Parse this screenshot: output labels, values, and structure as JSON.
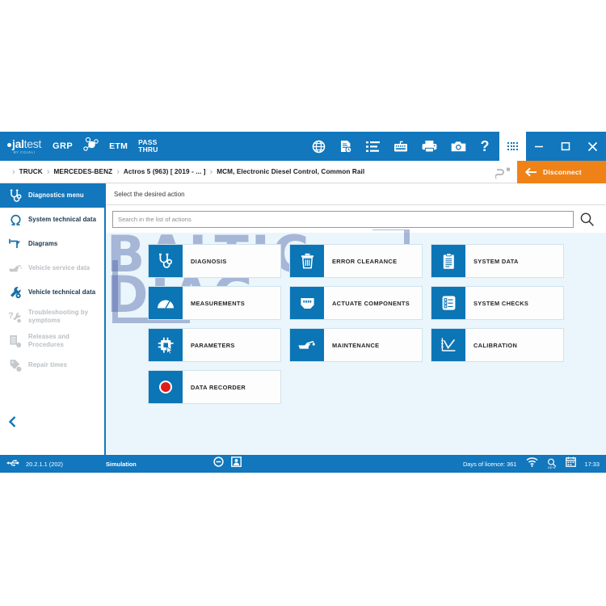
{
  "brand": {
    "logo_main": "jal",
    "logo_accent": "test",
    "logo_sub": "BY COJALI",
    "grp_label": "GRP",
    "etm_label": "ETM",
    "passthru_line1": "PASS",
    "passthru_line2": "THRU"
  },
  "colors": {
    "header_blue": "#1277bc",
    "tile_blue": "#0c75b5",
    "accent_orange": "#ef8217",
    "content_bg": "#eaf6fb",
    "watermark": "#4a5fa8",
    "record_red": "#e01b1b"
  },
  "toolbar": {
    "icons": [
      {
        "name": "globe-icon",
        "title": "Language"
      },
      {
        "name": "document-info-icon",
        "title": "Reports"
      },
      {
        "name": "list-icon",
        "title": "List"
      },
      {
        "name": "keyboard-icon",
        "title": "Keyboard"
      },
      {
        "name": "printer-icon",
        "title": "Print"
      },
      {
        "name": "camera-icon",
        "title": "Screenshot"
      },
      {
        "name": "help-icon",
        "title": "Help"
      }
    ],
    "apps_grid": "apps-grid-icon",
    "window_controls": [
      {
        "name": "minimize-button",
        "glyph": "minimize"
      },
      {
        "name": "maximize-button",
        "glyph": "maximize"
      },
      {
        "name": "close-button",
        "glyph": "close"
      }
    ]
  },
  "breadcrumb": {
    "items": [
      "TRUCK",
      "MERCEDES-BENZ",
      "Actros 5 (963) [ 2019 - ... ]",
      "MCM, Electronic Diesel Control, Common Rail"
    ],
    "separator": "›"
  },
  "disconnect": {
    "label": "Disconnect",
    "icon": "arrow-left-icon",
    "connector_icon": "connector-icon"
  },
  "sidebar": {
    "items": [
      {
        "label": "Diagnostics menu",
        "icon": "stethoscope-icon",
        "state": "active"
      },
      {
        "label": "System technical data",
        "icon": "omega-icon",
        "state": "enabled"
      },
      {
        "label": "Diagrams",
        "icon": "diagram-icon",
        "state": "enabled"
      },
      {
        "label": "Vehicle service data",
        "icon": "oil-can-icon",
        "state": "disabled"
      },
      {
        "label": "Vehicle technical data",
        "icon": "wrench-icon",
        "state": "enabled"
      },
      {
        "label": "Troubleshooting by symptoms",
        "icon": "question-wrench-icon",
        "state": "disabled"
      },
      {
        "label": "Releases and Procedures",
        "icon": "documents-icon",
        "state": "disabled"
      },
      {
        "label": "Repair times",
        "icon": "clock-tag-icon",
        "state": "disabled"
      }
    ],
    "collapse_icon": "chevron-left-icon"
  },
  "main": {
    "heading": "Select the desired action",
    "search": {
      "placeholder": "Search in the list of actions",
      "value": "",
      "icon": "search-icon"
    },
    "watermark": {
      "line1": "BALTIC",
      "line2": "DIAG"
    },
    "tiles": [
      {
        "label": "DIAGNOSIS",
        "icon": "stethoscope-icon"
      },
      {
        "label": "ERROR CLEARANCE",
        "icon": "trash-icon"
      },
      {
        "label": "SYSTEM DATA",
        "icon": "clipboard-icon"
      },
      {
        "label": "MEASUREMENTS",
        "icon": "gauge-icon"
      },
      {
        "label": "ACTUATE COMPONENTS",
        "icon": "connector-plug-icon"
      },
      {
        "label": "SYSTEM CHECKS",
        "icon": "checklist-icon"
      },
      {
        "label": "PARAMETERS",
        "icon": "chip-cursor-icon"
      },
      {
        "label": "MAINTENANCE",
        "icon": "oil-can-icon"
      },
      {
        "label": "CALIBRATION",
        "icon": "calibration-chart-icon"
      },
      {
        "label": "DATA RECORDER",
        "icon": "record-dot-icon"
      }
    ]
  },
  "statusbar": {
    "usb_icon": "usb-icon",
    "version": "20.2.1.1 (202)",
    "mode": "Simulation",
    "mid_icons": [
      {
        "name": "no-entry-icon"
      },
      {
        "name": "user-card-icon"
      }
    ],
    "licence": "Days of licence: 361",
    "wifi_icon": "wifi-icon",
    "zoom_icon": "zoom-icon",
    "zoom_level": "100 %",
    "calendar_icon": "calendar-icon",
    "time": "17:33"
  }
}
